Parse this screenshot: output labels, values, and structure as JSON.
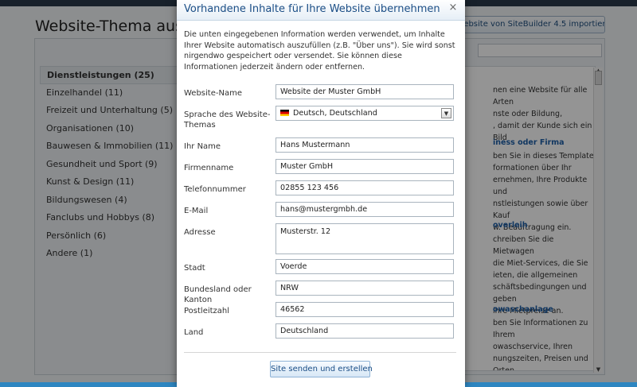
{
  "background": {
    "title": "Website-Thema auswä",
    "import_button": "Website von SiteBuilder 4.5 importieren",
    "categories": [
      "Dienstleistungen (25)",
      "Einzelhandel (11)",
      "Freizeit und Unterhaltung (5)",
      "Organisationen (10)",
      "Bauwesen & Immobilien (11)",
      "Gesundheit und Sport (9)",
      "Kunst & Design (11)",
      "Bildungswesen (4)",
      "Fanclubs und Hobbys (8)",
      "Persönlich (6)",
      "Andere (1)"
    ],
    "preview": {
      "intro_lines": [
        "nen eine Website für alle Arten",
        "nste oder Bildung,",
        ", damit der Kunde sich ein Bild"
      ],
      "section1_head": "iness oder Firma",
      "section1_lines": [
        "ben Sie in dieses Template",
        "formationen über Ihr",
        "ernehmen, Ihre Produkte und",
        "nstleistungen sowie über Kauf",
        "w. Beauftragung ein."
      ],
      "section2_head": "overleih",
      "section2_lines": [
        "chreiben Sie die Mietwagen",
        "die Miet-Services, die Sie",
        "ieten, die allgemeinen",
        "schäftsbedingungen und geben",
        "ihre Mietpreise an."
      ],
      "section3_head": "owaschanlage",
      "section3_lines": [
        "ben Sie Informationen zu Ihrem",
        "owaschservice, Ihren",
        "nungszeiten, Preisen und Orten"
      ]
    }
  },
  "dialog": {
    "title": "Vorhandene Inhalte für Ihre Website übernehmen",
    "close_symbol": "×",
    "intro": "Die unten eingegebenen Information werden verwendet, um Inhalte Ihrer Website automatisch auszufüllen (z.B. \"Über uns\"). Sie wird sonst nirgendwo gespeichert oder versendet. Sie können diese Informationen jederzeit ändern oder entfernen.",
    "fields": {
      "website_name": {
        "label": "Website-Name",
        "value": "Website der Muster GmbH"
      },
      "language": {
        "label": "Sprache des Website-Themas",
        "value": "Deutsch, Deutschland"
      },
      "your_name": {
        "label": "Ihr Name",
        "value": "Hans Mustermann"
      },
      "company": {
        "label": "Firmenname",
        "value": "Muster GmbH"
      },
      "phone": {
        "label": "Telefonnummer",
        "value": "02855 123 456"
      },
      "email": {
        "label": "E-Mail",
        "value": "hans@mustergmbh.de"
      },
      "address": {
        "label": "Adresse",
        "value": "Musterstr. 12"
      },
      "city": {
        "label": "Stadt",
        "value": "Voerde"
      },
      "state": {
        "label": "Bundesland oder Kanton",
        "value": "NRW"
      },
      "zip": {
        "label": "Postleitzahl",
        "value": "46562"
      },
      "country": {
        "label": "Land",
        "value": "Deutschland"
      }
    },
    "submit_label": "Site senden und erstellen"
  },
  "colors": {
    "dialog_title": "#1b4e86",
    "preview_heading": "#1e5fa8",
    "overlay": "#000000"
  }
}
